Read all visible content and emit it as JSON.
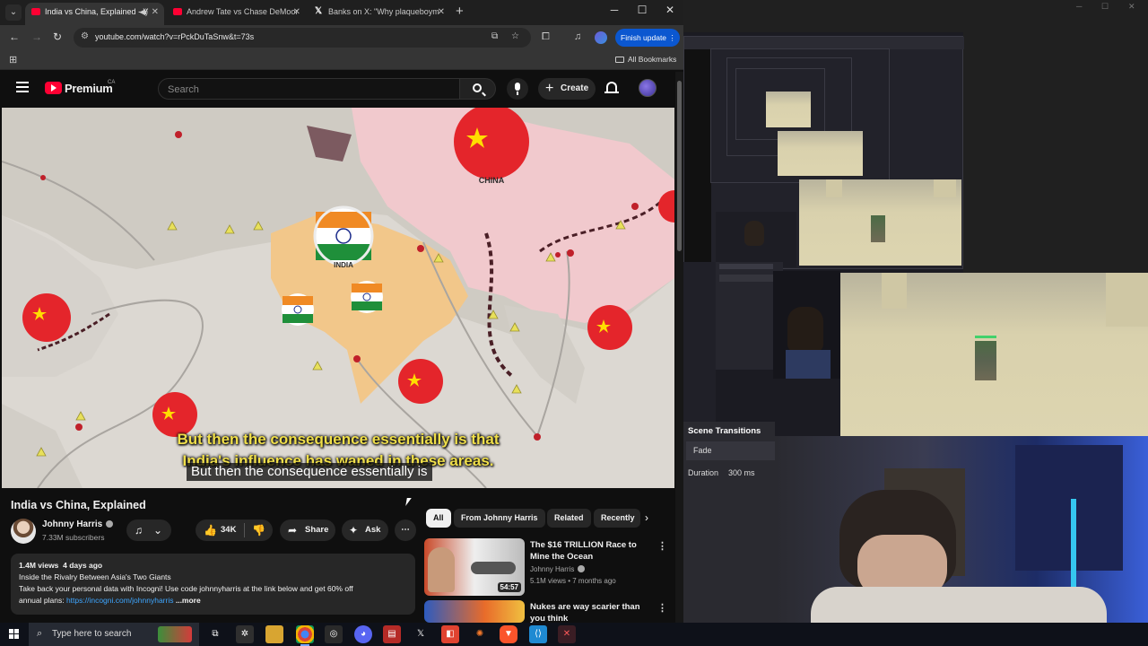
{
  "browser": {
    "tabs": [
      {
        "title": "India vs China, Explained - Y",
        "active": true,
        "audio": true
      },
      {
        "title": "Andrew Tate vs Chase DeMoor",
        "active": false
      },
      {
        "title": "Banks on X: \"Why plaqueboym",
        "active": false
      }
    ],
    "url": "youtube.com/watch?v=rPckDuTaSnw&t=73s",
    "finish_update_label": "Finish update",
    "all_bookmarks_label": "All Bookmarks"
  },
  "youtube": {
    "brand": "Premium",
    "country": "CA",
    "search_placeholder": "Search",
    "create_label": "Create",
    "video": {
      "title": "India vs China, Explained",
      "subtitle_line1": "But then the consequence essentially is that",
      "subtitle_line2": "India's influence has waned in these areas.",
      "caption_overlay": "But then the consequence essentially is",
      "map_labels": {
        "china": "CHINA",
        "india": "INDIA"
      }
    },
    "channel": {
      "name": "Johnny Harris",
      "subscribers": "7.33M subscribers"
    },
    "actions": {
      "likes": "34K",
      "share": "Share",
      "ask": "Ask"
    },
    "description": {
      "views": "1.4M views",
      "age": "4 days ago",
      "line1": "Inside the Rivalry Between Asia's Two Giants",
      "line2": "Take back your personal data with Incogni! Use code johnnyharris at the link below and get 60% off",
      "line3_prefix": "annual plans: ",
      "link": "https://incogni.com/johnnyharris",
      "more": "...more"
    },
    "chips": [
      "All",
      "From Johnny Harris",
      "Related",
      "Recently"
    ],
    "recommendations": [
      {
        "title": "The $16 TRILLION Race to Mine the Ocean",
        "channel": "Johnny Harris",
        "meta": "5.1M views • 7 months ago",
        "duration": "54:57"
      },
      {
        "title": "Nukes are way scarier than you think",
        "channel": "",
        "meta": "",
        "duration": ""
      }
    ]
  },
  "obs": {
    "scene_transitions_title": "Scene Transitions",
    "transition": "Fade",
    "duration_label": "Duration",
    "duration_value": "300 ms"
  },
  "taskbar": {
    "search_placeholder": "Type here to search",
    "apps": [
      "task-view",
      "app-1",
      "file-explorer",
      "chrome",
      "obs",
      "discord",
      "game-studio",
      "app-x",
      "app-red",
      "blender",
      "brave",
      "vscode",
      "app-last"
    ]
  },
  "colors": {
    "youtube_red": "#ff0033",
    "subtitle_yellow": "#f0df4a",
    "link_blue": "#3ea6ff",
    "update_blue": "#0b57d0"
  }
}
